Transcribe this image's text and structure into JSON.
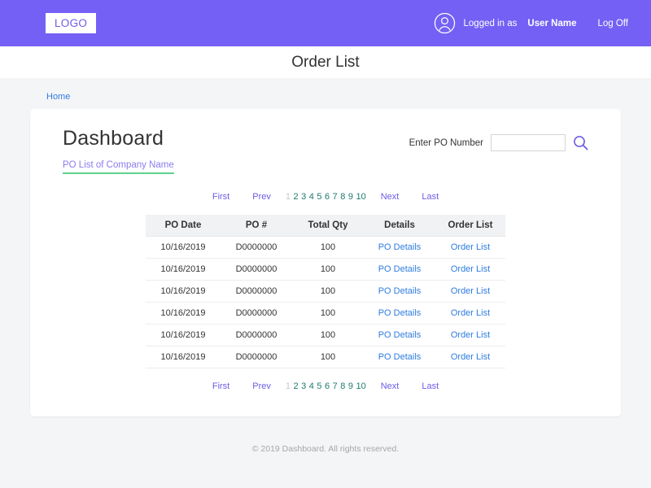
{
  "navbar": {
    "logo": "LOGO",
    "user_icon": "user-circle-icon",
    "logged_in_label": "Logged in as",
    "user_name": "User Name",
    "log_off": "Log Off",
    "background_color": "#7460f4"
  },
  "titlebar": {
    "title": "Order List"
  },
  "breadcrumb": {
    "home": "Home",
    "link_color": "#2f7ce0"
  },
  "card": {
    "title": "Dashboard",
    "tab_label": "PO List of Company Name",
    "tab_text_color": "#8a7bf0",
    "tab_underline_color": "#5fd38d",
    "search": {
      "label": "Enter PO Number",
      "value": "",
      "placeholder": "",
      "icon": "search-icon",
      "icon_color": "#6c5ce7"
    }
  },
  "pagination": {
    "first": "First",
    "prev": "Prev",
    "next": "Next",
    "last": "Last",
    "pages": [
      "1",
      "2",
      "3",
      "4",
      "5",
      "6",
      "7",
      "8",
      "9",
      "10"
    ],
    "current_page": "1",
    "edge_color": "#6c5ce7",
    "number_color": "#1f7a6e",
    "current_color": "#c9c9c9"
  },
  "table": {
    "columns": [
      "PO Date",
      "PO #",
      "Total Qty",
      "Details",
      "Order List"
    ],
    "rows": [
      {
        "po_date": "10/16/2019",
        "po_number": "D0000000",
        "total_qty": "100",
        "details": "PO Details",
        "order_list": "Order List"
      },
      {
        "po_date": "10/16/2019",
        "po_number": "D0000000",
        "total_qty": "100",
        "details": "PO Details",
        "order_list": "Order List"
      },
      {
        "po_date": "10/16/2019",
        "po_number": "D0000000",
        "total_qty": "100",
        "details": "PO Details",
        "order_list": "Order List"
      },
      {
        "po_date": "10/16/2019",
        "po_number": "D0000000",
        "total_qty": "100",
        "details": "PO Details",
        "order_list": "Order List"
      },
      {
        "po_date": "10/16/2019",
        "po_number": "D0000000",
        "total_qty": "100",
        "details": "PO Details",
        "order_list": "Order List"
      },
      {
        "po_date": "10/16/2019",
        "po_number": "D0000000",
        "total_qty": "100",
        "details": "PO Details",
        "order_list": "Order List"
      }
    ],
    "link_color": "#2f7ce0"
  },
  "footer": {
    "text": "© 2019 Dashboard. All rights reserved."
  }
}
